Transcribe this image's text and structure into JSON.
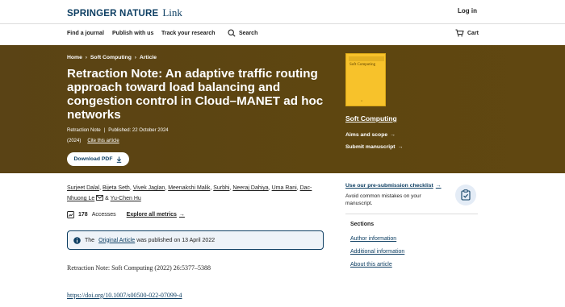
{
  "header": {
    "brand": "SPRINGER NATURE",
    "product": "Link",
    "login_label": "Log in"
  },
  "nav": {
    "items": [
      "Find a journal",
      "Publish with us",
      "Track your research"
    ],
    "search_label": "Search",
    "cart_label": "Cart"
  },
  "breadcrumb": [
    "Home",
    "Soft Computing",
    "Article"
  ],
  "article": {
    "title": "Retraction Note: An adaptive traffic routing approach toward load balancing and congestion control in Cloud–MANET ad hoc networks",
    "type": "Retraction Note",
    "published": "Published: 22 October 2024",
    "year": "(2024)",
    "cite_label": "Cite this article",
    "download_label": "Download PDF",
    "authors": [
      "Surjeet Dalal",
      "Bijeta Seth",
      "Vivek Jaglan",
      "Meenakshi Malik",
      "Surbhi",
      "Neeraj Dahiya",
      "Uma Rani",
      "Dac-Nhuong Le",
      "Yu-Chen Hu"
    ],
    "accesses_count": "178",
    "accesses_label": "Accesses",
    "explore_metrics": "Explore all metrics",
    "notice_prefix": "The",
    "notice_link": "Original Article",
    "notice_suffix": "was published on 13 April 2022",
    "retraction_text": "Retraction Note: Soft Computing (2022) 26:5377–5388",
    "doi": "https://doi.org/10.1007/s00500-022-07099-4"
  },
  "journal": {
    "name": "Soft Computing",
    "cover_title": "Soft Computing",
    "aims_label": "Aims and scope",
    "submit_label": "Submit manuscript"
  },
  "sidebar": {
    "checklist_link": "Use our pre-submission checklist",
    "checklist_desc": "Avoid common mistakes on your manuscript.",
    "sections_title": "Sections",
    "sections": [
      "Author information",
      "Additional information",
      "About this article"
    ]
  },
  "colors": {
    "hero_bg": "#5e4610",
    "brand_blue": "#0e3f63",
    "cover_yellow": "#f7c22b"
  }
}
